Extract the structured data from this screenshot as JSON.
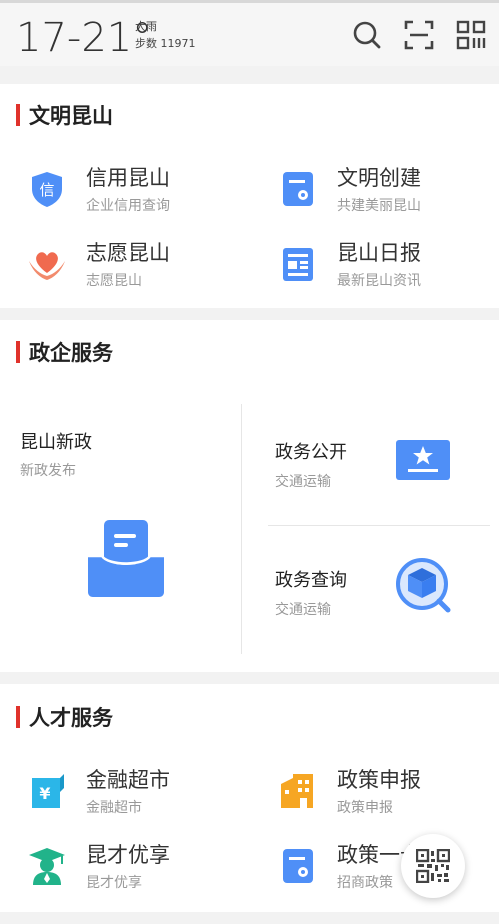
{
  "header": {
    "temperature": "17-21°",
    "weather": "大雨",
    "steps": "步数 11971",
    "icons": [
      "search-icon",
      "scan-icon",
      "qrcode-icon"
    ]
  },
  "sections": {
    "civility": {
      "title": "文明昆山",
      "items": [
        {
          "title": "信用昆山",
          "subtitle": "企业信用查询",
          "icon": "credit-shield-icon",
          "icon_text": "信"
        },
        {
          "title": "文明创建",
          "subtitle": "共建美丽昆山",
          "icon": "document-icon"
        },
        {
          "title": "志愿昆山",
          "subtitle": "志愿昆山",
          "icon": "heart-hands-icon"
        },
        {
          "title": "昆山日报",
          "subtitle": "最新昆山资讯",
          "icon": "newspaper-icon"
        }
      ]
    },
    "government": {
      "title": "政企服务",
      "main": {
        "title": "昆山新政",
        "subtitle": "新政发布",
        "icon": "inbox-icon"
      },
      "items": [
        {
          "title": "政务公开",
          "subtitle": "交通运输",
          "icon": "star-board-icon"
        },
        {
          "title": "政务查询",
          "subtitle": "交通运输",
          "icon": "cube-search-icon"
        }
      ]
    },
    "talent": {
      "title": "人才服务",
      "items": [
        {
          "title": "金融超市",
          "subtitle": "金融超市",
          "icon": "finance-icon",
          "icon_text": "¥"
        },
        {
          "title": "政策申报",
          "subtitle": "政策申报",
          "icon": "building-icon"
        },
        {
          "title": "昆才优享",
          "subtitle": "昆才优享",
          "icon": "graduate-icon"
        },
        {
          "title": "政策一卡",
          "subtitle": "招商政策",
          "icon": "document-icon"
        }
      ]
    }
  },
  "colors": {
    "accent": "#e0322b",
    "blue": "#4f8ff7",
    "cyan": "#2bb6e8",
    "orange": "#f6a623",
    "green": "#21b38a",
    "coral": "#f06a4f"
  }
}
